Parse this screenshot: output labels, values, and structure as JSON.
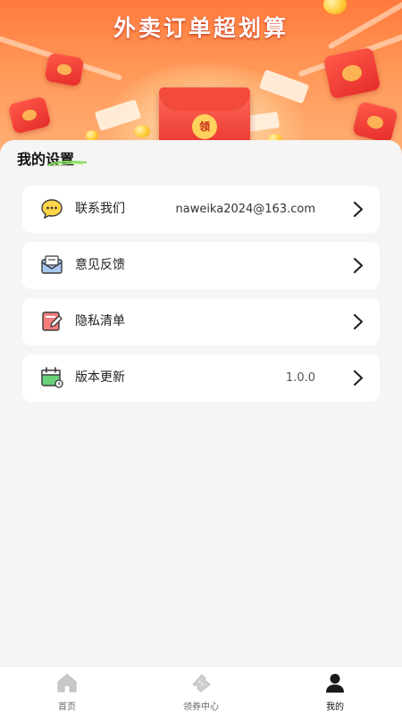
{
  "banner": {
    "title": "外卖订单超划算",
    "envelope_text": "领"
  },
  "settings": {
    "title": "我的设置",
    "items": [
      {
        "label": "联系我们",
        "value": "naweika2024@163.com",
        "icon": "chat-bubble-icon"
      },
      {
        "label": "意见反馈",
        "value": "",
        "icon": "mail-envelope-icon"
      },
      {
        "label": "隐私清单",
        "value": "",
        "icon": "edit-document-icon"
      },
      {
        "label": "版本更新",
        "value": "1.0.0",
        "icon": "calendar-update-icon"
      }
    ]
  },
  "tabbar": {
    "items": [
      {
        "label": "首页",
        "icon": "home-icon",
        "active": false
      },
      {
        "label": "领券中心",
        "icon": "ticket-icon",
        "active": false
      },
      {
        "label": "我的",
        "icon": "user-icon",
        "active": true
      }
    ]
  },
  "colors": {
    "banner_orange": "#ff7a3c",
    "accent_green": "#7ed957",
    "page_bg": "#f5f5f5",
    "active_tab": "#111111",
    "inactive_tab": "#999999"
  }
}
